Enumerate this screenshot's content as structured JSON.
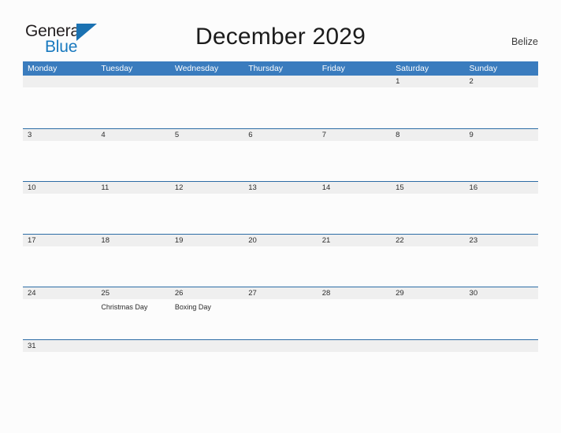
{
  "brand": {
    "name_part1": "General",
    "name_part2": "Blue",
    "flag_icon": "blue-triangle-flag-icon",
    "color_dark": "#231f20",
    "color_blue": "#1879bf"
  },
  "header": {
    "title": "December 2029",
    "region": "Belize",
    "accent_color": "#3a7cbe",
    "rule_color": "#2c6ca5",
    "daynum_band_color": "#efefef",
    "page_background": "#fcfcfc"
  },
  "calendar": {
    "weekdays": [
      "Monday",
      "Tuesday",
      "Wednesday",
      "Thursday",
      "Friday",
      "Saturday",
      "Sunday"
    ],
    "weeks": [
      [
        {
          "day": "",
          "event": ""
        },
        {
          "day": "",
          "event": ""
        },
        {
          "day": "",
          "event": ""
        },
        {
          "day": "",
          "event": ""
        },
        {
          "day": "",
          "event": ""
        },
        {
          "day": "1",
          "event": ""
        },
        {
          "day": "2",
          "event": ""
        }
      ],
      [
        {
          "day": "3",
          "event": ""
        },
        {
          "day": "4",
          "event": ""
        },
        {
          "day": "5",
          "event": ""
        },
        {
          "day": "6",
          "event": ""
        },
        {
          "day": "7",
          "event": ""
        },
        {
          "day": "8",
          "event": ""
        },
        {
          "day": "9",
          "event": ""
        }
      ],
      [
        {
          "day": "10",
          "event": ""
        },
        {
          "day": "11",
          "event": ""
        },
        {
          "day": "12",
          "event": ""
        },
        {
          "day": "13",
          "event": ""
        },
        {
          "day": "14",
          "event": ""
        },
        {
          "day": "15",
          "event": ""
        },
        {
          "day": "16",
          "event": ""
        }
      ],
      [
        {
          "day": "17",
          "event": ""
        },
        {
          "day": "18",
          "event": ""
        },
        {
          "day": "19",
          "event": ""
        },
        {
          "day": "20",
          "event": ""
        },
        {
          "day": "21",
          "event": ""
        },
        {
          "day": "22",
          "event": ""
        },
        {
          "day": "23",
          "event": ""
        }
      ],
      [
        {
          "day": "24",
          "event": ""
        },
        {
          "day": "25",
          "event": "Christmas Day"
        },
        {
          "day": "26",
          "event": "Boxing Day"
        },
        {
          "day": "27",
          "event": ""
        },
        {
          "day": "28",
          "event": ""
        },
        {
          "day": "29",
          "event": ""
        },
        {
          "day": "30",
          "event": ""
        }
      ],
      [
        {
          "day": "31",
          "event": ""
        },
        {
          "day": "",
          "event": ""
        },
        {
          "day": "",
          "event": ""
        },
        {
          "day": "",
          "event": ""
        },
        {
          "day": "",
          "event": ""
        },
        {
          "day": "",
          "event": ""
        },
        {
          "day": "",
          "event": ""
        }
      ]
    ]
  }
}
